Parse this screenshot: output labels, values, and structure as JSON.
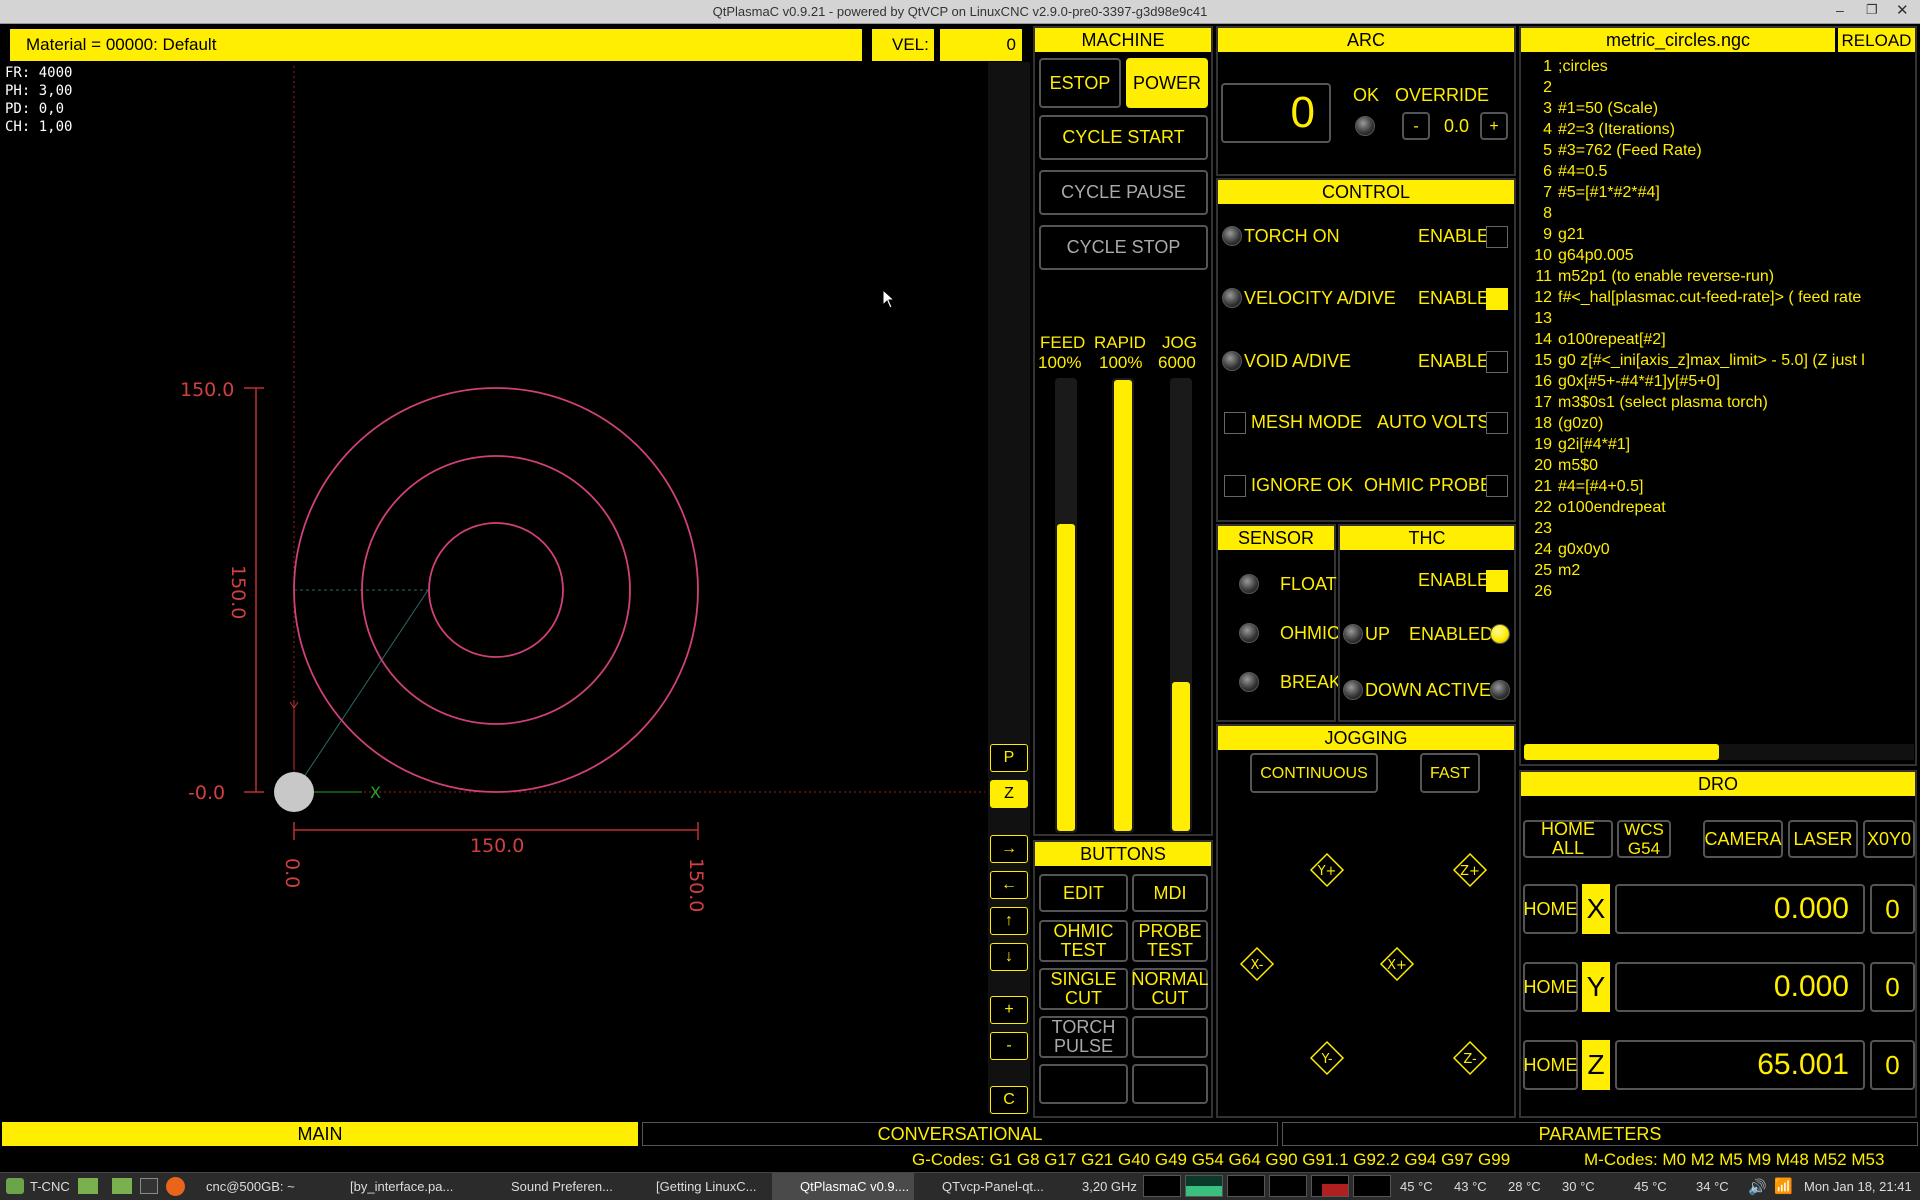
{
  "window": {
    "title": "QtPlasmaC v0.9.21 - powered by QtVCP on LinuxCNC v2.9.0-pre0-3397-g3d98e9c41"
  },
  "status": {
    "material": "Material = 00000: Default",
    "vel_label": "VEL:",
    "vel_value": "0"
  },
  "overlay": {
    "fr": "FR: 4000",
    "ph": "PH: 3,00",
    "pd": "PD: 0,0",
    "ch": "CH: 1,00"
  },
  "preview": {
    "y_top": "150.0",
    "y_mid": "150.0",
    "y_bottom": "-0.0",
    "x_mid": "150.0",
    "x_left": "0.0",
    "x_right": "150.0",
    "axis_x": "X"
  },
  "sidebuttons": {
    "p": "P",
    "z": "Z",
    "right": "→",
    "left": "←",
    "up": "↑",
    "down": "↓",
    "plus": "+",
    "minus": "-",
    "c": "C"
  },
  "machine": {
    "header": "MACHINE",
    "estop": "ESTOP",
    "power": "POWER",
    "cycle_start": "CYCLE START",
    "cycle_pause": "CYCLE PAUSE",
    "cycle_stop": "CYCLE STOP",
    "feed_label": "FEED",
    "feed_value": "100%",
    "rapid_label": "RAPID",
    "rapid_value": "100%",
    "jog_label": "JOG",
    "jog_value": "6000",
    "feed_level": 0.68,
    "rapid_level": 1.0,
    "jog_level": 0.33
  },
  "buttons": {
    "header": "BUTTONS",
    "edit": "EDIT",
    "mdi": "MDI",
    "ohmic_test_1": "OHMIC",
    "ohmic_test_2": "TEST",
    "probe_test_1": "PROBE",
    "probe_test_2": "TEST",
    "single_cut_1": "SINGLE",
    "single_cut_2": "CUT",
    "normal_cut_1": "NORMAL",
    "normal_cut_2": "CUT",
    "torch_pulse_1": "TORCH",
    "torch_pulse_2": "PULSE"
  },
  "arc": {
    "header": "ARC",
    "voltage": "0",
    "ok": "OK",
    "override": "OVERRIDE",
    "minus": "-",
    "override_value": "0.0",
    "plus": "+"
  },
  "control": {
    "header": "CONTROL",
    "torch_on": "TORCH ON",
    "velocity_adive": "VELOCITY A/DIVE",
    "void_adive": "VOID A/DIVE",
    "enable": "ENABLE",
    "mesh_mode": "MESH MODE",
    "auto_volts": "AUTO VOLTS",
    "ignore_ok": "IGNORE OK",
    "ohmic_probe": "OHMIC PROBE"
  },
  "sensor": {
    "header": "SENSOR",
    "float": "FLOAT",
    "ohmic": "OHMIC",
    "break": "BREAK"
  },
  "thc": {
    "header": "THC",
    "enable": "ENABLE",
    "up": "UP",
    "enabled": "ENABLED",
    "down": "DOWN",
    "active": "ACTIVE"
  },
  "jogging": {
    "header": "JOGGING",
    "continuous": "CONTINUOUS",
    "fast": "FAST",
    "y_plus": "Y+",
    "z_plus": "Z+",
    "x_minus": "X-",
    "x_plus": "X+",
    "y_minus": "Y-",
    "z_minus": "Z-"
  },
  "gcode": {
    "filename": "metric_circles.ngc",
    "reload": "RELOAD",
    "progress": 0.5,
    "lines": [
      {
        "n": "1",
        "t": ";circles"
      },
      {
        "n": "2",
        "t": ""
      },
      {
        "n": "3",
        "t": "#1=50 (Scale)"
      },
      {
        "n": "4",
        "t": "#2=3 (Iterations)"
      },
      {
        "n": "5",
        "t": "#3=762 (Feed Rate)"
      },
      {
        "n": "6",
        "t": "#4=0.5"
      },
      {
        "n": "7",
        "t": "#5=[#1*#2*#4]"
      },
      {
        "n": "8",
        "t": ""
      },
      {
        "n": "9",
        "t": "g21"
      },
      {
        "n": "10",
        "t": "g64p0.005"
      },
      {
        "n": "11",
        "t": "m52p1 (to enable reverse-run)"
      },
      {
        "n": "12",
        "t": "f#<_hal[plasmac.cut-feed-rate]> ( feed rate"
      },
      {
        "n": "13",
        "t": ""
      },
      {
        "n": "14",
        "t": "o100repeat[#2]"
      },
      {
        "n": "15",
        "t": "g0 z[#<_ini[axis_z]max_limit> - 5.0] (Z just l"
      },
      {
        "n": "16",
        "t": "g0x[#5+-#4*#1]y[#5+0]"
      },
      {
        "n": "17",
        "t": "m3$0s1 (select plasma torch)"
      },
      {
        "n": "18",
        "t": "(g0z0)"
      },
      {
        "n": "19",
        "t": "g2i[#4*#1]"
      },
      {
        "n": "20",
        "t": "m5$0"
      },
      {
        "n": "21",
        "t": "#4=[#4+0.5]"
      },
      {
        "n": "22",
        "t": "o100endrepeat"
      },
      {
        "n": "23",
        "t": ""
      },
      {
        "n": "24",
        "t": "g0x0y0"
      },
      {
        "n": "25",
        "t": "m2"
      },
      {
        "n": "26",
        "t": ""
      }
    ]
  },
  "dro": {
    "header": "DRO",
    "home_all": "HOME ALL",
    "wcs_1": "WCS",
    "wcs_2": "G54",
    "camera": "CAMERA",
    "laser": "LASER",
    "x0y0": "X0Y0",
    "home": "HOME",
    "x_label": "X",
    "x_value": "0.000",
    "x_offset": "0",
    "y_label": "Y",
    "y_value": "0.000",
    "y_offset": "0",
    "z_label": "Z",
    "z_value": "65.001",
    "z_offset": "0"
  },
  "tabs": {
    "main": "MAIN",
    "conversational": "CONVERSATIONAL",
    "parameters": "PARAMETERS"
  },
  "codes": {
    "gcodes": "G-Codes: G1 G8 G17 G21 G40 G49 G54 G64 G90 G91.1 G92.2 G94 G97 G99",
    "mcodes": "M-Codes: M0 M2 M5 M9 M48 M52 M53"
  },
  "taskbar": {
    "menu": "T-CNC",
    "items": [
      "cnc@500GB: ~",
      "[by_interface.pa...",
      "Sound Preferen...",
      "[Getting LinuxC...",
      "QtPlasmaC v0.9....",
      "QTvcp-Panel-qt..."
    ],
    "cpu_freq": "3,20 GHz",
    "temps": [
      "45 °C",
      "43 °C",
      "28 °C",
      "30 °C",
      "45 °C",
      "34 °C"
    ],
    "clock": "Mon Jan 18, 21:41"
  },
  "colors": {
    "accent": "#ffee00",
    "toolpath": "#d0407a",
    "background": "#000000"
  }
}
